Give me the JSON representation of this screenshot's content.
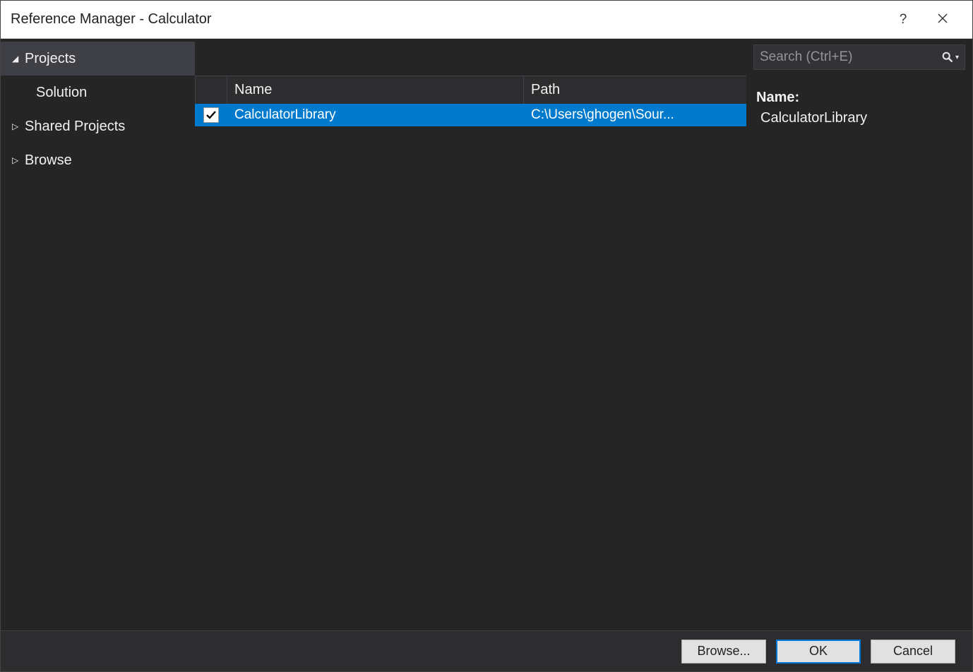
{
  "window": {
    "title": "Reference Manager - Calculator"
  },
  "sidebar": {
    "projects": "Projects",
    "solution": "Solution",
    "shared": "Shared Projects",
    "browse": "Browse"
  },
  "table": {
    "headers": {
      "name": "Name",
      "path": "Path"
    },
    "rows": [
      {
        "checked": true,
        "name": "CalculatorLibrary",
        "path": "C:\\Users\\ghogen\\Sour..."
      }
    ]
  },
  "search": {
    "placeholder": "Search (Ctrl+E)"
  },
  "details": {
    "label": "Name:",
    "value": "CalculatorLibrary"
  },
  "footer": {
    "browse": "Browse...",
    "ok": "OK",
    "cancel": "Cancel"
  }
}
